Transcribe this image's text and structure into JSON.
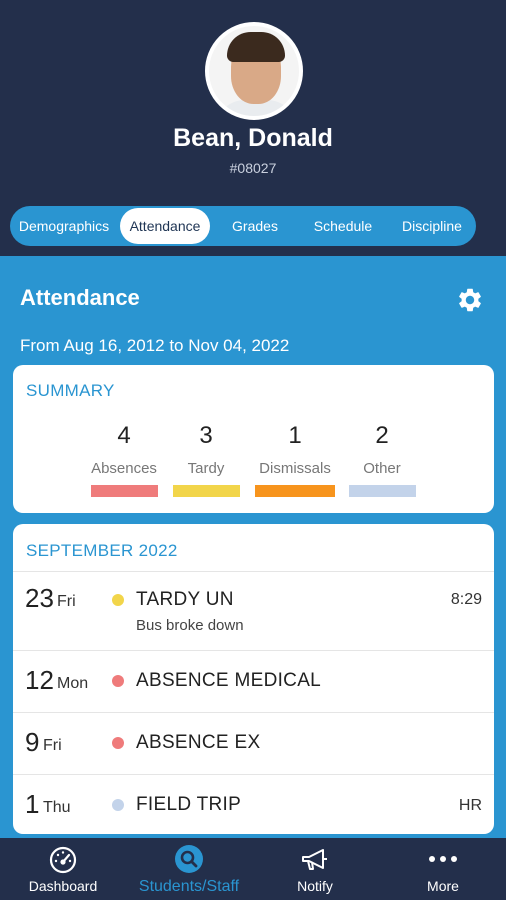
{
  "student": {
    "name": "Bean, Donald",
    "id": "#08027"
  },
  "tabs": [
    {
      "label": "Demographics",
      "active": false
    },
    {
      "label": "Attendance",
      "active": true
    },
    {
      "label": "Grades",
      "active": false
    },
    {
      "label": "Schedule",
      "active": false
    },
    {
      "label": "Discipline",
      "active": false
    }
  ],
  "attendance": {
    "title": "Attendance",
    "settings_icon": "gear-icon",
    "date_range": "From Aug 16, 2012 to Nov 04, 2022"
  },
  "summary": {
    "heading": "SUMMARY",
    "stats": [
      {
        "count": "4",
        "label": "Absences",
        "color": "#ef7b7b"
      },
      {
        "count": "3",
        "label": "Tardy",
        "color": "#f2d54a"
      },
      {
        "count": "1",
        "label": "Dismissals",
        "color": "#f7941d"
      },
      {
        "count": "2",
        "label": "Other",
        "color": "#c3d3ea"
      }
    ]
  },
  "month": {
    "heading": "SEPTEMBER 2022",
    "entries": [
      {
        "day": "23",
        "weekday": "Fri",
        "code": "TARDY UN",
        "note": "Bus broke down",
        "right": "8:29",
        "color": "#f2d54a"
      },
      {
        "day": "12",
        "weekday": "Mon",
        "code": "ABSENCE MEDICAL",
        "note": "",
        "right": "",
        "color": "#ef7b7b"
      },
      {
        "day": "9",
        "weekday": "Fri",
        "code": "ABSENCE EX",
        "note": "",
        "right": "",
        "color": "#ef7b7b"
      },
      {
        "day": "1",
        "weekday": "Thu",
        "code": "FIELD TRIP",
        "note": "",
        "right": "HR",
        "color": "#c3d3ea"
      }
    ]
  },
  "nav": [
    {
      "label": "Dashboard",
      "icon": "dashboard-gauge-icon",
      "active": false
    },
    {
      "label": "Students/Staff",
      "icon": "search-icon",
      "active": true
    },
    {
      "label": "Notify",
      "icon": "megaphone-icon",
      "active": false
    },
    {
      "label": "More",
      "icon": "more-dots-icon",
      "active": false
    }
  ],
  "colors": {
    "header_bg": "#232f4b",
    "accent": "#2a95d1"
  }
}
